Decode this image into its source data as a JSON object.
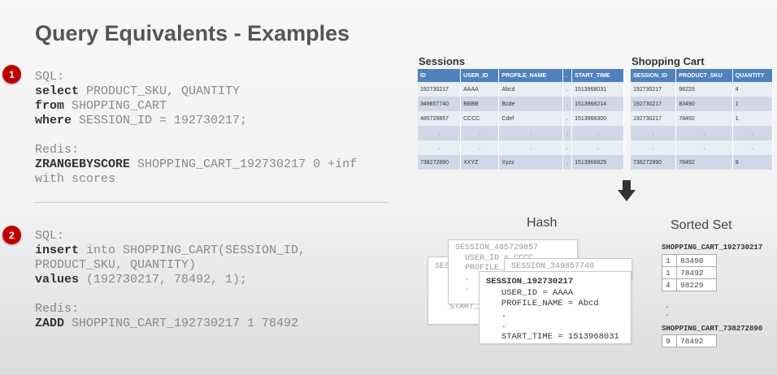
{
  "title": "Query Equivalents - Examples",
  "example1": {
    "badge": "1",
    "sql_label": "SQL:",
    "line1_kw": "select",
    "line1_rest": " PRODUCT_SKU, QUANTITY",
    "line2_kw": "from",
    "line2_rest": " SHOPPING_CART",
    "line3_kw": "where",
    "line3_rest": " SESSION_ID = 192730217;",
    "redis_label": "Redis:",
    "redis_kw": "ZRANGEBYSCORE",
    "redis_rest": " SHOPPING_CART_192730217 0 +inf",
    "redis_line2": "with scores"
  },
  "example2": {
    "badge": "2",
    "sql_label": "SQL:",
    "line1_kw": "insert",
    "line1_rest": " into SHOPPING_CART(SESSION_ID,",
    "line2": "PRODUCT_SKU, QUANTITY)",
    "line3_kw": "values",
    "line3_rest": " (192730217, 78492, 1);",
    "redis_label": "Redis:",
    "redis_kw": "ZADD",
    "redis_rest": " SHOPPING_CART_192730217 1 78492"
  },
  "sessions": {
    "title": "Sessions",
    "headers": [
      "ID",
      "USER_ID",
      "PROFILE_NAME",
      ".",
      "START_TIME"
    ],
    "rows": [
      [
        "192730217",
        "AAAA",
        "Abcd",
        ".",
        "1513968031"
      ],
      [
        "349857740",
        "BBBB",
        "Bcde",
        ".",
        "1513968214"
      ],
      [
        "485729857",
        "CCCC",
        "Cdef",
        ".",
        "1513968300"
      ],
      [
        ".",
        ".",
        ".",
        ".",
        "."
      ],
      [
        ".",
        ".",
        ".",
        ".",
        "."
      ],
      [
        "738272890",
        "XXYZ",
        "Xyzz",
        ".",
        "1513968825"
      ]
    ]
  },
  "cart": {
    "title": "Shopping Cart",
    "headers": [
      "SESSION_ID",
      "PRODUCT_SKU",
      "QUANTITY"
    ],
    "rows": [
      [
        "192730217",
        "98229",
        "4"
      ],
      [
        "192730217",
        "83490",
        "1"
      ],
      [
        "192730217",
        "78492",
        "1"
      ],
      [
        ".",
        ".",
        "."
      ],
      [
        ".",
        ".",
        "."
      ],
      [
        "738272890",
        "78492",
        "9"
      ]
    ]
  },
  "hash": {
    "label": "Hash",
    "back_key": "SESSION_485729857",
    "back_line1": "USER_ID = CCCC",
    "back_line2": "PROFILE_N",
    "back_line3": ".",
    "back_line4": ".",
    "left_key": "SES",
    "left_line": "START_T",
    "mid_key": "SESSION_349857740",
    "front_key": "SESSION_192730217",
    "front_line1": "USER_ID = AAAA",
    "front_line2": "PROFILE_NAME = Abcd",
    "front_line3": ".",
    "front_line4": ".",
    "front_line5": "START_TIME = 1513968031"
  },
  "sorted_set": {
    "label": "Sorted Set",
    "key1": "SHOPPING_CART_192730217",
    "entries1": [
      [
        "1",
        "83490"
      ],
      [
        "1",
        "78492"
      ],
      [
        "4",
        "98229"
      ]
    ],
    "dots": ".",
    "key2": "SHOPPING_CART_738272890",
    "entries2": [
      [
        "9",
        "78492"
      ]
    ]
  }
}
